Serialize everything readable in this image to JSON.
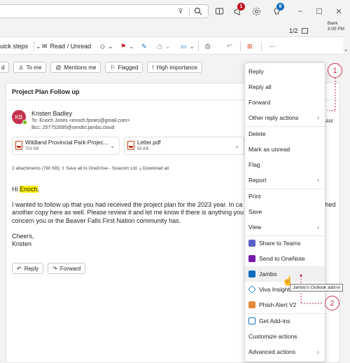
{
  "topbar": {
    "badge1": "1",
    "badge2": "9",
    "win_minimize": "–",
    "win_maximize": "☐",
    "win_close": "✕"
  },
  "pager": "1/2",
  "bank": {
    "name": "Bank",
    "time": "3:00 PM"
  },
  "toolbar": {
    "quick_steps": "uick steps",
    "read_unread": "Read / Unread"
  },
  "filters": {
    "first": "d",
    "to_me": "To me",
    "mentions": "Mentions me",
    "flagged": "Flagged",
    "high_importance": "High importance"
  },
  "message": {
    "subject": "Project Plan Follow up",
    "avatar_initials": "KB",
    "sender": "Kristen Badley",
    "to": "To: Enoch Jones <enoch.fjones@gmail.com>",
    "bcc": "Bcc: 257752695@sendto.jambo.cloud",
    "time": "AM",
    "attachments": [
      {
        "name": "Wildland Provincial Park-Projec...",
        "size": "701 KB"
      },
      {
        "name": "Letter.pdf",
        "size": "55 KB"
      }
    ],
    "attachment_summary": "2 attachments (760 KB)   ⇪  Save all to OneDrive - Sivacom Ltd.   ⤓  Download all",
    "greeting_prefix": "Hi ",
    "greeting_name": "Enoch",
    "greeting_suffix": ",",
    "body1": "I wanted to follow up that you had received the project plan for the 2023 year. In ca",
    "body1_tail": "ched",
    "body2": "another copy here as well. Please review it and let me know if there is anything you",
    "body3": "concern you or the Beaver Falls First Nation community has.",
    "signoff1": "Cheers,",
    "signoff2": "Kristen",
    "reply": "Reply",
    "forward": "Forward"
  },
  "menu": {
    "items": [
      "Reply",
      "Reply all",
      "Forward",
      "Other reply actions",
      "Delete",
      "Mark as unread",
      "Flag",
      "Report",
      "Print",
      "Save",
      "View",
      "Share to Teams",
      "Send to OneNote",
      "Jambo",
      "Viva Insights",
      "Phish Alert V2",
      "Get Add-ins",
      "Customize actions",
      "Advanced actions"
    ]
  },
  "tooltip": "Jambo's Outlook add-in",
  "callouts": {
    "one": "1",
    "two": "2"
  },
  "colors": {
    "callout": "#c4314b",
    "avatar": "#c4314b",
    "highlight": "#fff100",
    "teams": "#5b5fc7",
    "onenote": "#7719aa",
    "jambo": "#0f6cbd",
    "phish": "#e8893a"
  }
}
